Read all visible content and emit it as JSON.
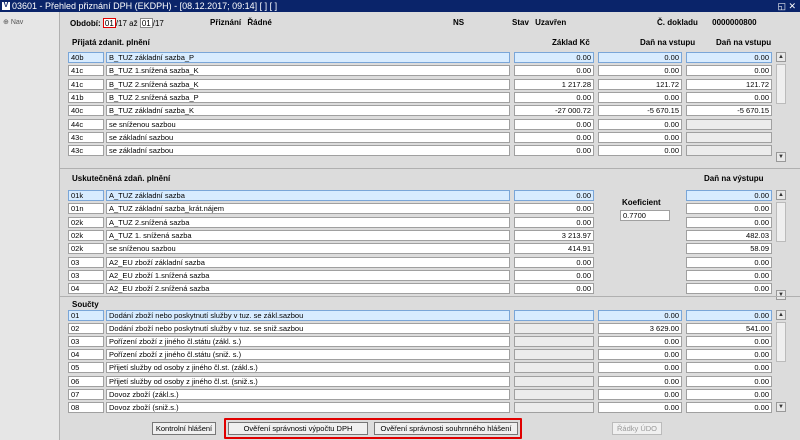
{
  "window": {
    "title": "03601 - Přehled přiznání DPH (EKDPH) - [08.12.2017; 09:14] [ ] [ ]",
    "controls": "◱ ✕"
  },
  "leftpane": {
    "nav_label": "Nav"
  },
  "header": {
    "obdobi_label": "Období:",
    "from_month": "01",
    "from_year": "/17",
    "az_label": "až",
    "to_month": "01",
    "to_year": "/17",
    "priznani_label": "Přiznání",
    "priznani_value": "Řádné",
    "ns_label": "NS",
    "stav_label": "Stav",
    "stav_value": "Uzavřen",
    "doklad_label": "Č. dokladu",
    "doklad_value": "0000000800"
  },
  "section1": {
    "title": "Přijatá zdanit. plnění",
    "col_base": "Základ Kč",
    "col_dan_vstup": "Daň na vstupu",
    "col_dan_vstup2": "Daň na vstupu",
    "rows": [
      {
        "code": "40b",
        "desc": "B_TUZ základní sazba_P",
        "base": "0.00",
        "dan1": "0.00",
        "dan2": "0.00"
      },
      {
        "code": "41c",
        "desc": "B_TUZ 1.snížená sazba_K",
        "base": "0.00",
        "dan1": "0.00",
        "dan2": "0.00"
      },
      {
        "code": "41c",
        "desc": "B_TUZ 2.snížená sazba_K",
        "base": "1 217.28",
        "dan1": "121.72",
        "dan2": "121.72"
      },
      {
        "code": "41b",
        "desc": "B_TUZ 2.snížená sazba_P",
        "base": "0.00",
        "dan1": "0.00",
        "dan2": "0.00"
      },
      {
        "code": "40c",
        "desc": "B_TUZ základní sazba_K",
        "base": "-27 000.72",
        "dan1": "-5 670.15",
        "dan2": "-5 670.15"
      },
      {
        "code": "44c",
        "desc": "se sníženou sazbou",
        "base": "0.00",
        "dan1": "0.00",
        "dan2": ""
      },
      {
        "code": "43c",
        "desc": "se základní sazbou",
        "base": "0.00",
        "dan1": "0.00",
        "dan2": ""
      },
      {
        "code": "43c",
        "desc": "se základní sazbou",
        "base": "0.00",
        "dan1": "0.00",
        "dan2": ""
      }
    ]
  },
  "section2": {
    "title": "Uskutečněná zdaň. plnění",
    "col_dan_vystup": "Daň na výstupu",
    "koef_label": "Koeficient",
    "koef_value": "0.7700",
    "rows": [
      {
        "code": "01k",
        "desc": "A_TUZ základní sazba",
        "base": "0.00",
        "dan": "0.00"
      },
      {
        "code": "01n",
        "desc": "A_TUZ základní sazba_krát.nájem",
        "base": "0.00",
        "dan": "0.00"
      },
      {
        "code": "02k",
        "desc": "A_TUZ 2.snížená sazba",
        "base": "0.00",
        "dan": "0.00"
      },
      {
        "code": "02k",
        "desc": "A_TUZ 1. snížená sazba",
        "base": "3 213.97",
        "dan": "482.03"
      },
      {
        "code": "02k",
        "desc": "se sníženou sazbou",
        "base": "414.91",
        "dan": "58.09"
      },
      {
        "code": "03",
        "desc": "A2_EU zboží základní sazba",
        "base": "0.00",
        "dan": "0.00"
      },
      {
        "code": "03",
        "desc": "A2_EU zboží 1.snížená sazba",
        "base": "0.00",
        "dan": "0.00"
      },
      {
        "code": "04",
        "desc": "A2_EU zboží 2.snížená sazba",
        "base": "0.00",
        "dan": "0.00"
      }
    ]
  },
  "section3": {
    "title": "Součty",
    "rows": [
      {
        "code": "01",
        "desc": "Dodání zboží nebo poskytnutí služby v tuz. se zákl.sazbou",
        "base": "0.00",
        "dan": "0.00"
      },
      {
        "code": "02",
        "desc": "Dodání zboží nebo poskytnutí služby v tuz. se sniž.sazbou",
        "base": "3 629.00",
        "dan": "541.00"
      },
      {
        "code": "03",
        "desc": "Pořízení zboží z jiného čl.státu (zákl. s.)",
        "base": "0.00",
        "dan": "0.00"
      },
      {
        "code": "04",
        "desc": "Pořízení zboží z jiného čl.státu (sniž. s.)",
        "base": "0.00",
        "dan": "0.00"
      },
      {
        "code": "05",
        "desc": "Přijetí služby od osoby z jiného čl.st. (zákl.s.)",
        "base": "0.00",
        "dan": "0.00"
      },
      {
        "code": "06",
        "desc": "Přijetí služby od osoby z jiného čl.st. (sniž.s.)",
        "base": "0.00",
        "dan": "0.00"
      },
      {
        "code": "07",
        "desc": "Dovoz zboží (zákl.s.)",
        "base": "0.00",
        "dan": "0.00"
      },
      {
        "code": "08",
        "desc": "Dovoz zboží (sniž.s.)",
        "base": "0.00",
        "dan": "0.00"
      }
    ]
  },
  "buttons": {
    "kontrolni": "Kontrolní hlášení",
    "overeni_dph": "Ověření správnosti výpočtu DPH",
    "overeni_souhrn": "Ověření správnosti souhrnného hlášení",
    "radky_udo": "Řádky ÚDO"
  },
  "colors": {
    "titlebar": "#0a246a",
    "selected_row": "#d8ecff",
    "highlight": "#e00000"
  }
}
